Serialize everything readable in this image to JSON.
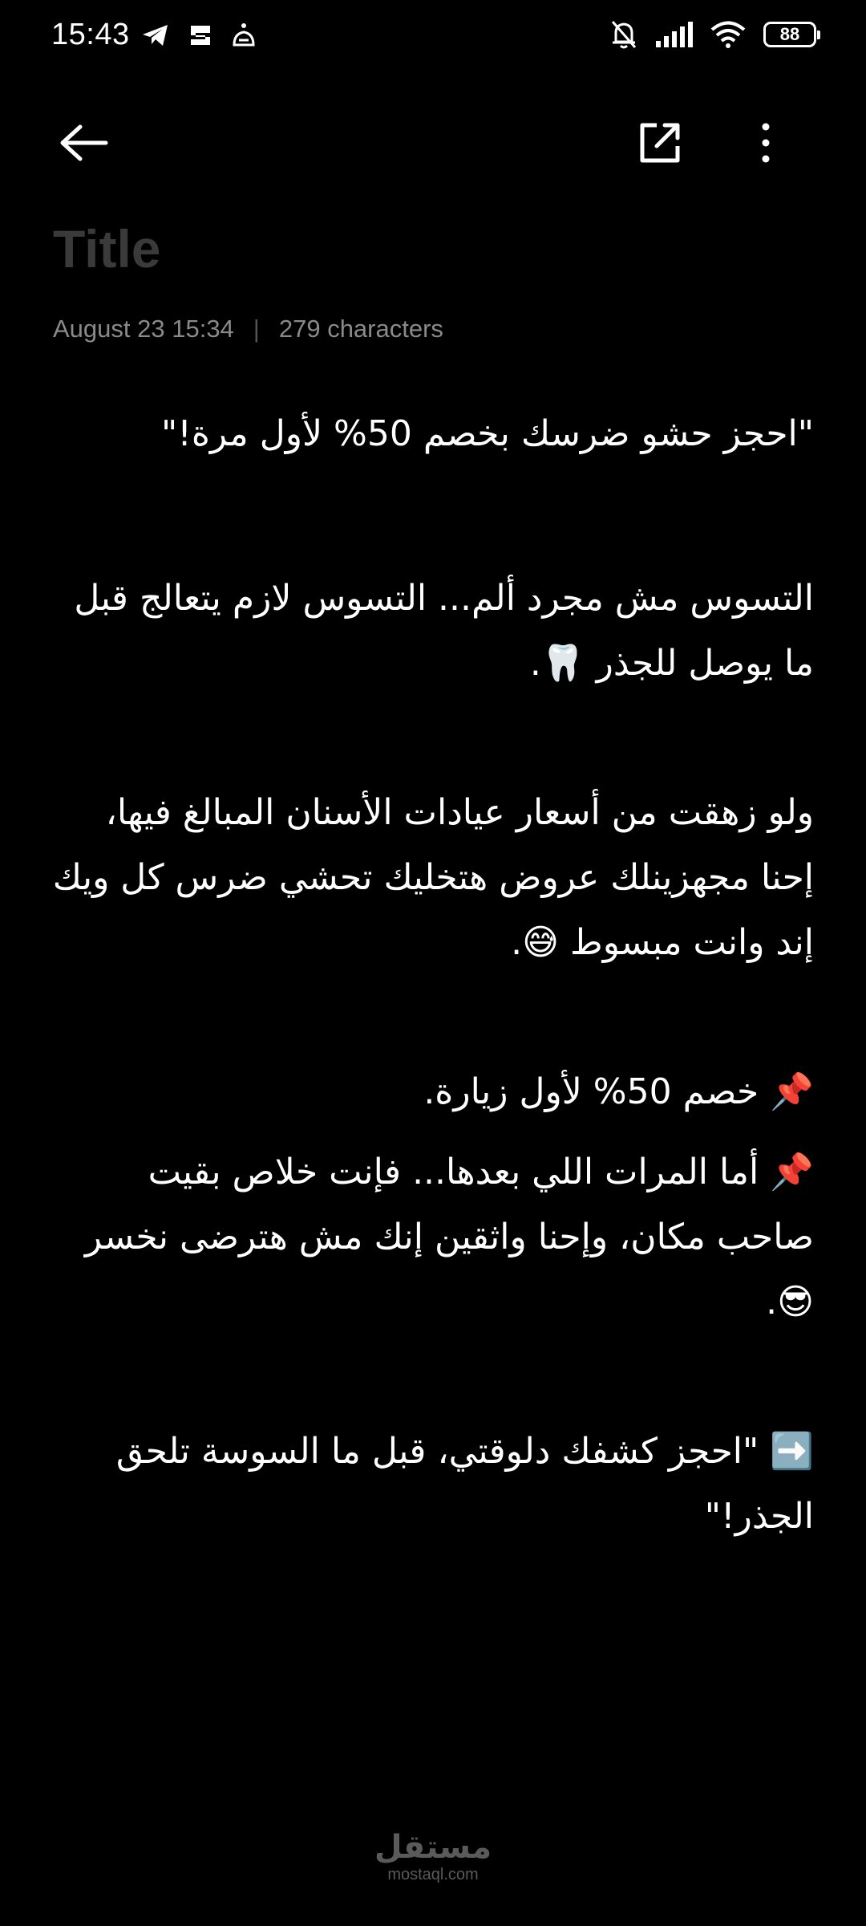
{
  "status_bar": {
    "time": "15:43",
    "battery": "88",
    "left_icons": [
      "telegram-icon",
      "notification-icon",
      "app-icon"
    ],
    "right_icons": [
      "bell-muted-icon",
      "signal-icon",
      "wifi-icon",
      "battery-icon"
    ]
  },
  "toolbar": {
    "back_icon": "arrow-left-icon",
    "share_icon": "share-external-icon",
    "more_icon": "more-vertical-icon"
  },
  "note": {
    "title_placeholder": "Title",
    "date": "August 23  15:34",
    "char_count": "279 characters",
    "paragraphs": [
      "\"احجز حشو ضرسك بخصم 50% لأول مرة!\"",
      "التسوس مش مجرد ألم... التسوس لازم يتعالج قبل ما يوصل للجذر 🦷.",
      "ولو زهقت من أسعار عيادات الأسنان المبالغ فيها، إحنا مجهزينلك عروض هتخليك تحشي ضرس كل ويك إند وانت مبسوط 😅.",
      "📌 خصم 50% لأول زيارة.",
      "📌 أما المرات اللي بعدها... فإنت خلاص بقيت صاحب مكان، وإحنا واثقين إنك مش هترضى نخسر 😎.",
      "➡️ \"احجز كشفك دلوقتي، قبل ما السوسة تلحق الجذر!\""
    ]
  },
  "watermark": {
    "arabic": "مستقل",
    "latin": "mostaql.com"
  }
}
